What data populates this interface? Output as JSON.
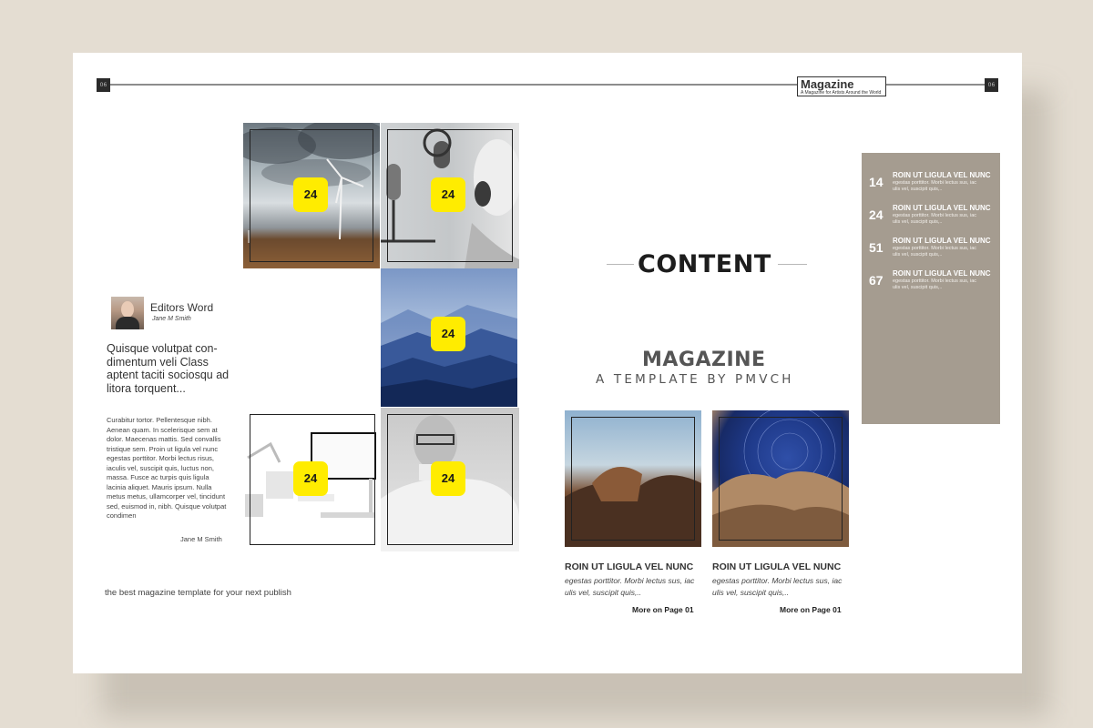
{
  "header": {
    "page_left": "06",
    "page_right": "06",
    "masthead_title": "Magazine",
    "masthead_subtitle": "A Magazine for Artists Around the World"
  },
  "photo_grid": {
    "badges": [
      "24",
      "24",
      "24",
      "24",
      "24"
    ]
  },
  "editor": {
    "title": "Editors Word",
    "name": "Jane M Smith",
    "lead": "Quisque volutpat con-dimentum veli Class aptent taciti sociosqu ad litora torquent...",
    "body": "Curabitur tortor. Pellentesque nibh. Aenean quam. In scelerisque sem at dolor. Maecenas mattis. Sed convallis tristique sem. Proin ut ligula vel nunc egestas porttitor. Morbi lectus risus, iaculis vel, suscipit quis, luctus non, massa. Fusce ac turpis quis ligula lacinia aliquet. Mauris ipsum. Nulla metus metus, ullamcorper vel, tincidunt sed, euismod in, nibh. Quisque volutpat condimen",
    "signature": "Jane M Smith"
  },
  "tagline": "the best magazine template for your next publish",
  "content_section": {
    "title": "CONTENT",
    "magazine_title": "MAGAZINE",
    "magazine_subtitle": "A TEMPLATE BY PMVCH"
  },
  "articles": [
    {
      "heading": "ROIN UT LIGULA VEL NUNC",
      "text": "egestas porttitor. Morbi lectus sus, iac ulis vel, suscipit quis,..",
      "more": "More on Page 01"
    },
    {
      "heading": "ROIN UT LIGULA VEL NUNC",
      "text": "egestas porttitor. Morbi lectus sus, iac ulis vel, suscipit quis,..",
      "more": "More on Page 01"
    }
  ],
  "toc": [
    {
      "page": "14",
      "heading": "ROIN UT LIGULA VEL NUNC",
      "text": "egestas porttitor. Morbi lectus sus, iac ulis vel, suscipit quis,.."
    },
    {
      "page": "24",
      "heading": "ROIN UT LIGULA VEL NUNC",
      "text": "egestas porttitor. Morbi lectus sus, iac ulis vel, suscipit quis,.."
    },
    {
      "page": "51",
      "heading": "ROIN UT LIGULA VEL NUNC",
      "text": "egestas porttitor. Morbi lectus sus, iac ulis vel, suscipit quis,.."
    },
    {
      "page": "67",
      "heading": "ROIN UT LIGULA VEL NUNC",
      "text": "egestas porttitor. Morbi lectus sus, iac ulis vel, suscipit quis,.."
    }
  ],
  "colors": {
    "background": "#e4ddd2",
    "page": "#ffffff",
    "badge": "#ffec00",
    "toc_box": "#a59c90"
  }
}
